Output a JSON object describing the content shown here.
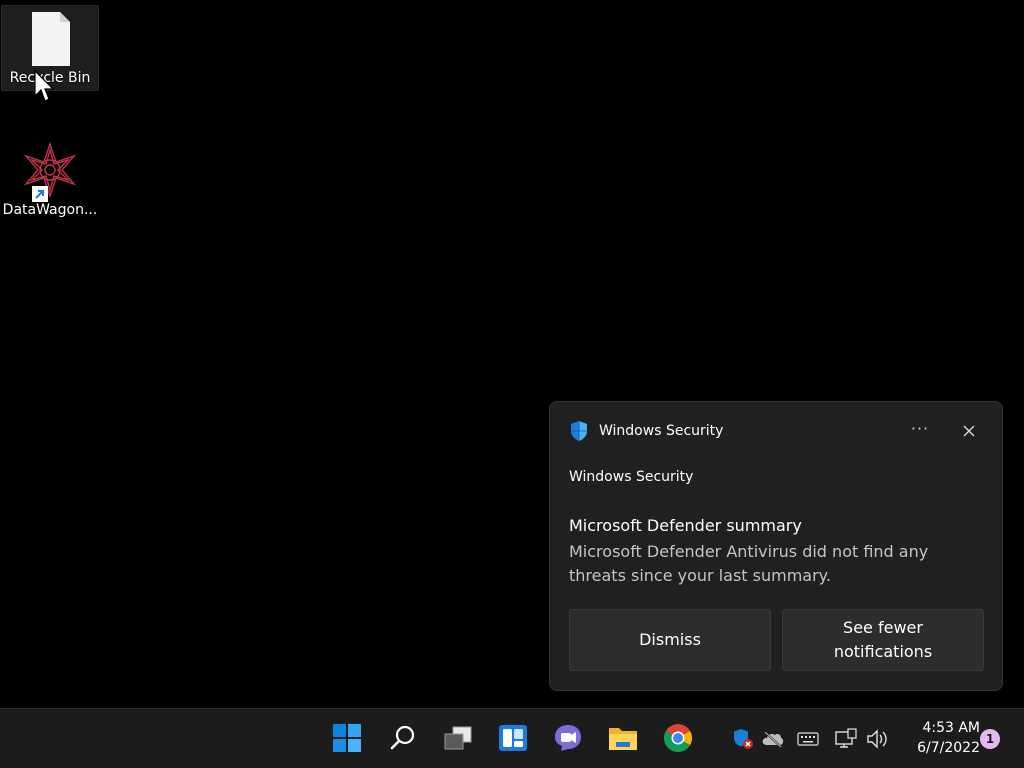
{
  "desktop": {
    "icons": [
      {
        "label": "Recycle Bin",
        "icon": "recycle-bin-icon"
      },
      {
        "label": "DataWagon...",
        "icon": "datawagon-app-icon"
      }
    ]
  },
  "toast": {
    "app_name": "Windows Security",
    "more_label": "···",
    "source": "Windows Security",
    "title": "Microsoft Defender summary",
    "body": "Microsoft Defender Antivirus did not find any threats since your last summary.",
    "buttons": {
      "dismiss": "Dismiss",
      "fewer": "See fewer notifications"
    }
  },
  "taskbar": {
    "pinned": [
      "start-icon",
      "search-icon",
      "task-view-icon",
      "widgets-icon",
      "chat-icon",
      "file-explorer-icon",
      "chrome-icon"
    ],
    "tray": [
      "windows-security-icon",
      "onedrive-icon",
      "keyboard-icon",
      "network-icon",
      "volume-icon"
    ],
    "clock": {
      "time": "4:53 AM",
      "date": "6/7/2022"
    },
    "notification_count": "1"
  },
  "colors": {
    "accent": "#0078d4",
    "toast_bg": "#202020",
    "taskbar_bg": "#1c1c1c",
    "badge": "#e4b8f2"
  }
}
